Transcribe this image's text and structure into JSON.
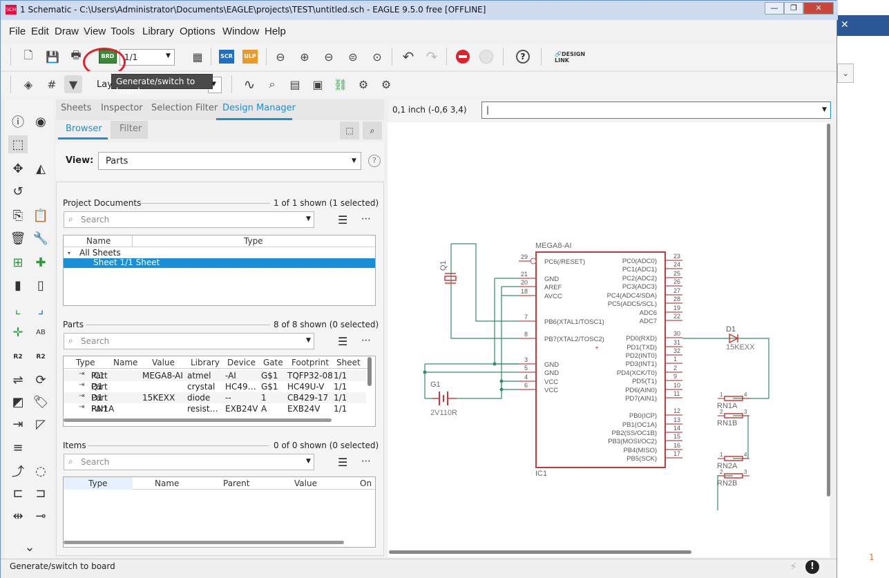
{
  "window": {
    "title": "1 Schematic - C:\\Users\\Administrator\\Documents\\EAGLE\\projects\\TEST\\untitled.sch - EAGLE 9.5.0 free [OFFLINE]",
    "app_icon": "SCH"
  },
  "menu": [
    "File",
    "Edit",
    "Draw",
    "View",
    "Tools",
    "Library",
    "Options",
    "Window",
    "Help"
  ],
  "toolbar": {
    "sheet_value": "1/1",
    "scr_label": "SCR",
    "ulp_label": "ULP",
    "brd_label": "BRD",
    "design_link": "DESIGN LINK",
    "layer_label": "Lay",
    "help_label": "?"
  },
  "tooltip": "Generate/switch to board",
  "panel_tabs": [
    "Sheets",
    "Inspector",
    "Selection Filter",
    "Design Manager"
  ],
  "active_tab": "Design Manager",
  "subtabs": [
    "Browser",
    "Filter"
  ],
  "view": {
    "label": "View:",
    "value": "Parts"
  },
  "project_documents": {
    "title": "Project Documents",
    "count": "1 of 1 shown (1 selected)",
    "search_placeholder": "Search",
    "columns": [
      "Name",
      "Type"
    ],
    "rows": [
      "All Sheets",
      "Sheet 1/1 Sheet"
    ]
  },
  "parts": {
    "title": "Parts",
    "count": "8 of 8 shown (0 selected)",
    "search_placeholder": "Search",
    "columns": [
      "Type",
      "Name",
      "Value",
      "Library",
      "Device",
      "Gate",
      "Footprint",
      "Sheet"
    ],
    "rows": [
      [
        "Part",
        "IC1",
        "MEGA8-AI",
        "atmel",
        "-AI",
        "G$1",
        "TQFP32-08",
        "1/1"
      ],
      [
        "Part",
        "Q1",
        "",
        "crystal",
        "HC49…",
        "G$1",
        "HC49U-V",
        "1/1"
      ],
      [
        "Part",
        "D1",
        "15KEXX",
        "diode",
        "--",
        "1",
        "CB429-17",
        "1/1"
      ],
      [
        "Part",
        "RN1A",
        "",
        "resist…",
        "EXB24V",
        "A",
        "EXB24V",
        "1/1"
      ]
    ]
  },
  "items": {
    "title": "Items",
    "count": "0 of 0 shown (0 selected)",
    "search_placeholder": "Search",
    "columns": [
      "Type",
      "Name",
      "Parent",
      "Value",
      "On"
    ]
  },
  "coord": {
    "text": "0,1 inch (-0,6 3,4)",
    "command_value": "|"
  },
  "status": {
    "text": "Generate/switch to board"
  },
  "schematic": {
    "ic_name": "MEGA8-AI",
    "ic_ref": "IC1",
    "left_pins": [
      {
        "num": "29",
        "name": "PC6(/RESET)"
      },
      {
        "num": "21",
        "name": "GND"
      },
      {
        "num": "20",
        "name": "AREF"
      },
      {
        "num": "18",
        "name": "AVCC"
      },
      {
        "num": "7",
        "name": "PB6(XTAL1/TOSC1)"
      },
      {
        "num": "8",
        "name": "PB7(XTAL2/TOSC2)"
      },
      {
        "num": "3",
        "name": "GND"
      },
      {
        "num": "5",
        "name": "GND"
      },
      {
        "num": "4",
        "name": "VCC"
      },
      {
        "num": "6",
        "name": "VCC"
      }
    ],
    "right_pins": [
      {
        "num": "23",
        "name": "PC0(ADC0)"
      },
      {
        "num": "24",
        "name": "PC1(ADC1)"
      },
      {
        "num": "25",
        "name": "PC2(ADC2)"
      },
      {
        "num": "26",
        "name": "PC3(ADC3)"
      },
      {
        "num": "27",
        "name": "PC4(ADC4/SDA)"
      },
      {
        "num": "28",
        "name": "PC5(ADC5/SCL)"
      },
      {
        "num": "19",
        "name": "ADC6"
      },
      {
        "num": "22",
        "name": "ADC7"
      },
      {
        "num": "30",
        "name": "PD0(RXD)"
      },
      {
        "num": "31",
        "name": "PD1(TXD)"
      },
      {
        "num": "32",
        "name": "PD2(INT0)"
      },
      {
        "num": "1",
        "name": "PD3(INT1)"
      },
      {
        "num": "2",
        "name": "PD4(XCK/T0)"
      },
      {
        "num": "9",
        "name": "PD5(T1)"
      },
      {
        "num": "10",
        "name": "PD6(AIN0)"
      },
      {
        "num": "11",
        "name": "PD7(AIN1)"
      },
      {
        "num": "12",
        "name": "PB0(ICP)"
      },
      {
        "num": "13",
        "name": "PB1(OC1A)"
      },
      {
        "num": "14",
        "name": "PB2(SS/OC1B)"
      },
      {
        "num": "15",
        "name": "PB3(MOSI/OC2)"
      },
      {
        "num": "16",
        "name": "PB4(MISO)"
      },
      {
        "num": "17",
        "name": "PB5(SCK)"
      }
    ],
    "q1": "Q1",
    "g1": "G1",
    "g1_value": "2V110R",
    "d1": "D1",
    "d1_value": "15KEXX",
    "rn": [
      "RN1A",
      "RN1B",
      "RN2A",
      "RN2B"
    ]
  },
  "colors": {
    "accent": "#1a8ed6",
    "wire": "#2e8f62",
    "part": "#c83a3a",
    "pin": "#b84a4a"
  }
}
